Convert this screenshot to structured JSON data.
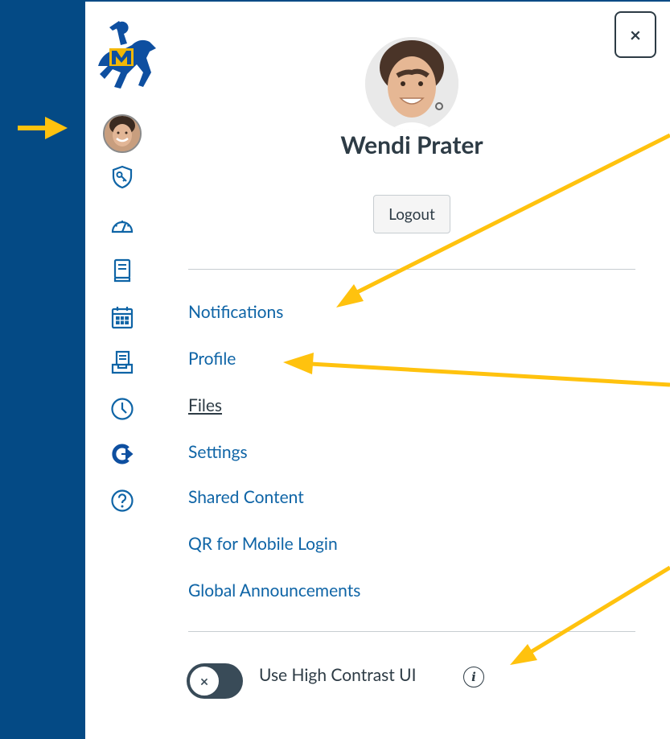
{
  "user": {
    "name": "Wendi Prater",
    "logout_label": "Logout"
  },
  "close_label": "×",
  "menu": {
    "items": [
      {
        "label": "Notifications"
      },
      {
        "label": "Profile"
      },
      {
        "label": "Files",
        "active": true
      },
      {
        "label": "Settings"
      },
      {
        "label": "Shared Content"
      },
      {
        "label": "QR for Mobile Login"
      },
      {
        "label": "Global Announcements"
      }
    ]
  },
  "high_contrast": {
    "label": "Use High Contrast UI",
    "toggle_symbol": "×",
    "info_symbol": "i",
    "enabled": false
  },
  "nav_rail": {
    "icons": [
      "account-icon",
      "admin-icon",
      "dashboard-icon",
      "courses-icon",
      "calendar-icon",
      "inbox-icon",
      "history-icon",
      "commons-icon",
      "help-icon"
    ]
  },
  "colors": {
    "brand_blue": "#044a85",
    "link_blue": "#0e64a6",
    "text_dark": "#2d3b45",
    "annotation_yellow": "#ffc20e"
  }
}
